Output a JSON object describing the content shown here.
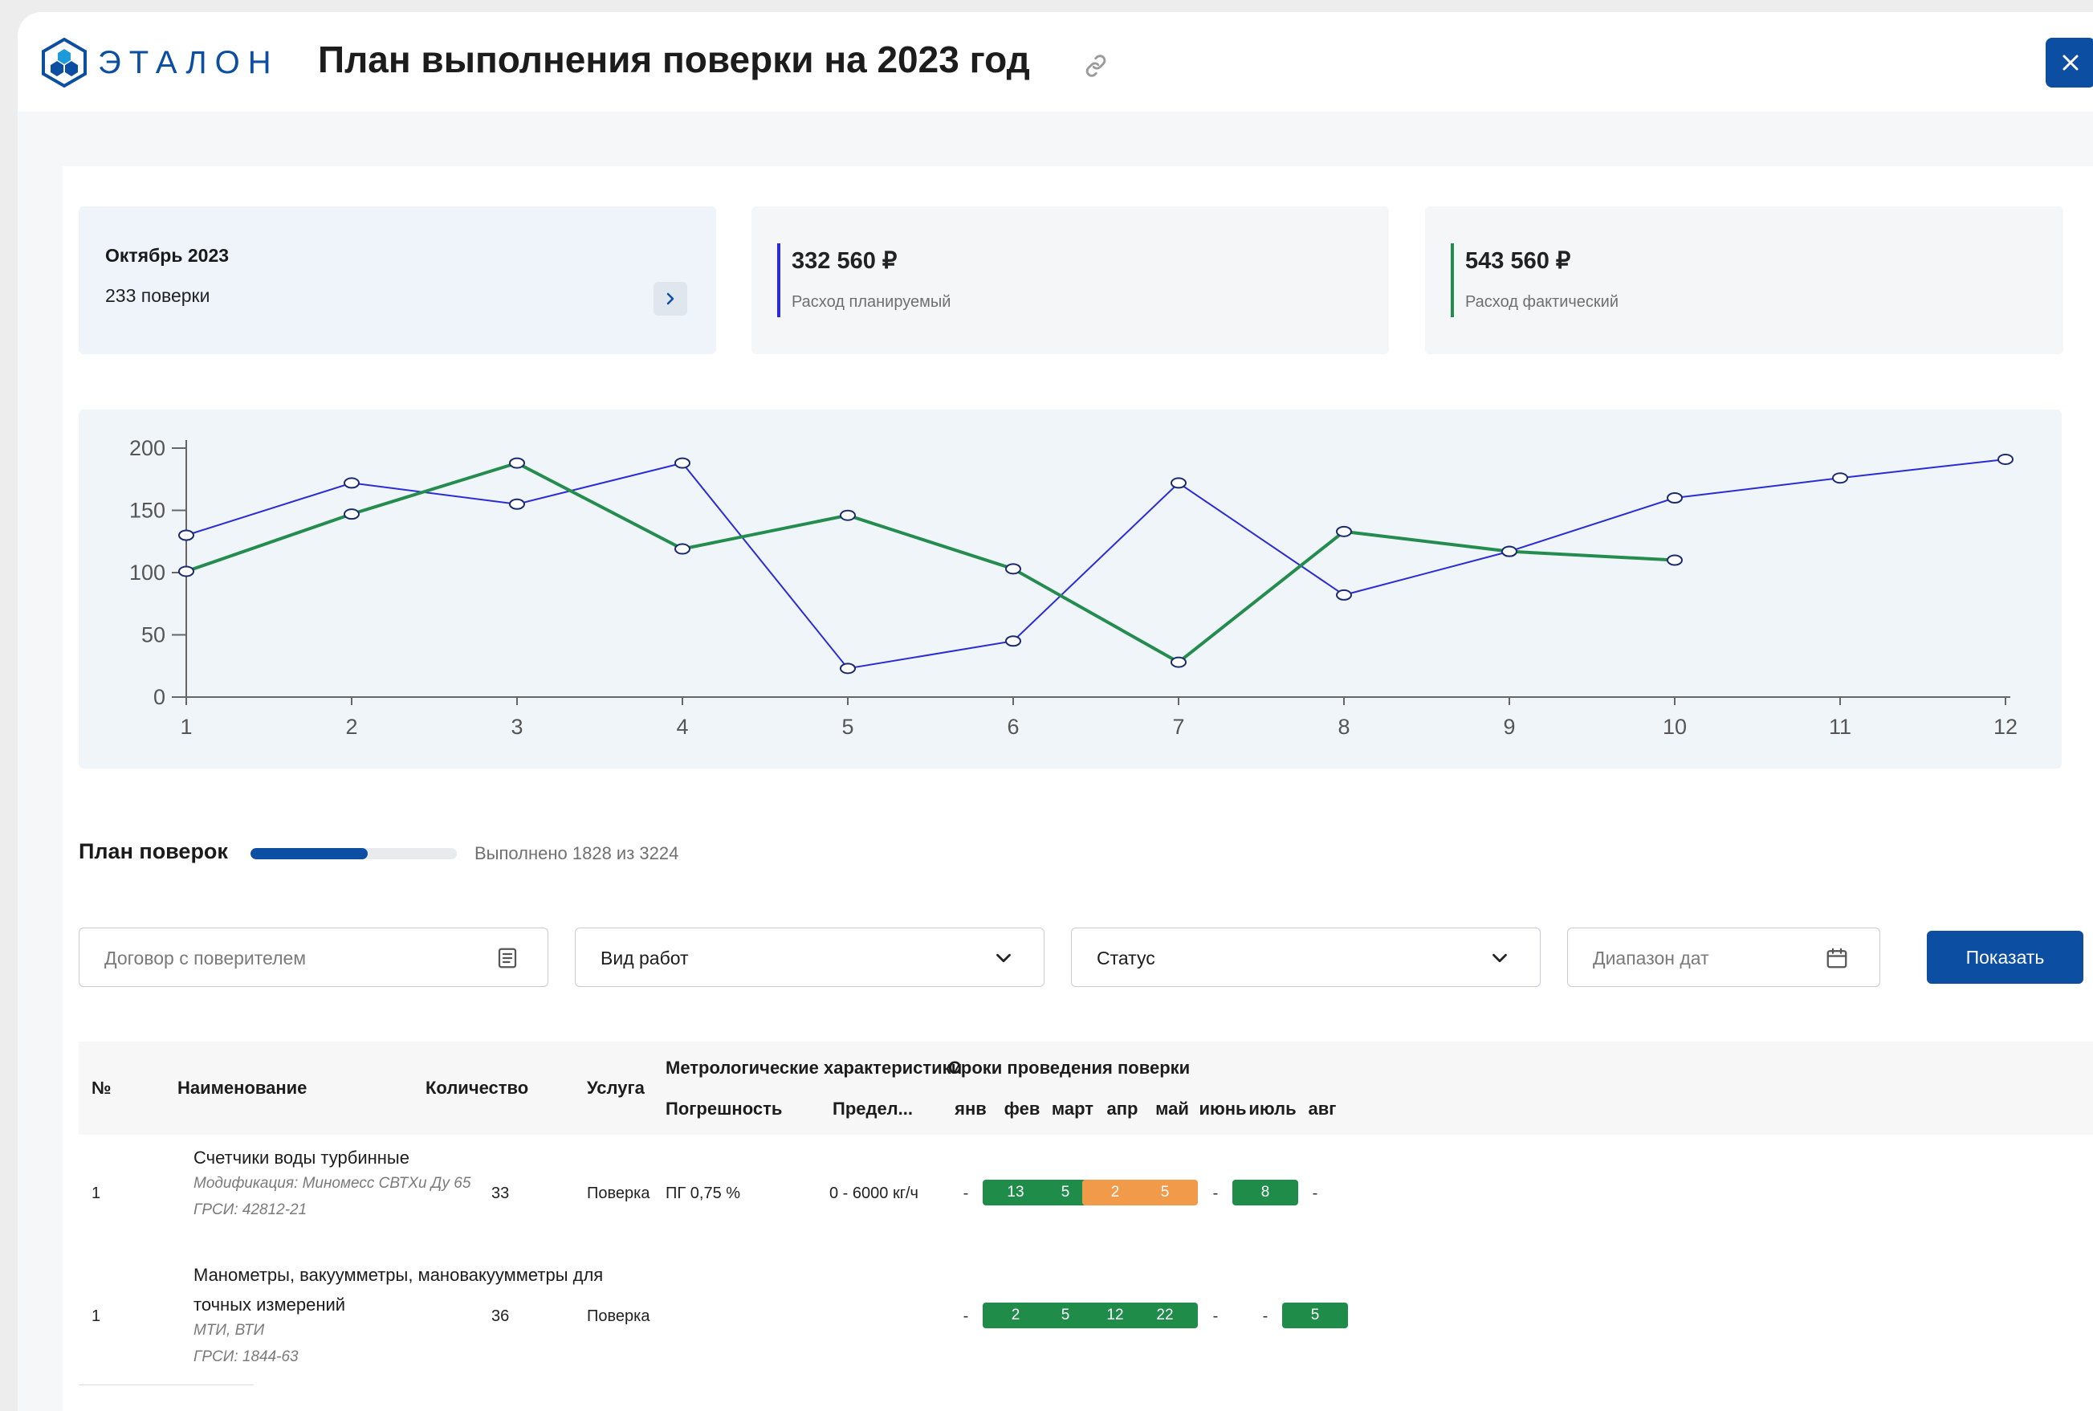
{
  "app": {
    "logo_text": "ЭТАЛОН",
    "title": "План выполнения поверки на 2023 год"
  },
  "summary": {
    "period": {
      "title": "Октябрь 2023",
      "subtitle": "233 поверки"
    },
    "planned": {
      "amount": "332 560 ₽",
      "label": "Расход планируемый",
      "color": "#2b2bd6"
    },
    "actual": {
      "amount": "543 560 ₽",
      "label": "Расход фактический",
      "color": "#238c4e"
    }
  },
  "chart_data": {
    "type": "line",
    "x": [
      1,
      2,
      3,
      4,
      5,
      6,
      7,
      8,
      9,
      10,
      11,
      12
    ],
    "xlim": [
      1,
      12
    ],
    "ylim": [
      0,
      200
    ],
    "yticks": [
      0,
      50,
      100,
      150,
      200
    ],
    "series": [
      {
        "color": "#2b2bd6",
        "values": [
          130,
          172,
          155,
          188,
          23,
          45,
          172,
          82,
          117,
          160,
          176,
          191
        ]
      },
      {
        "color": "#238c4e",
        "values": [
          101,
          147,
          188,
          119,
          146,
          103,
          28,
          133,
          117,
          110
        ]
      }
    ]
  },
  "plan": {
    "title": "План поверок",
    "progress_text": "Выполнено 1828 из 3224",
    "done": 1828,
    "total": 3224
  },
  "filters": {
    "contract_placeholder": "Договор с поверителем",
    "work_type": "Вид работ",
    "status": "Статус",
    "date_range_placeholder": "Диапазон дат",
    "show_button": "Показать"
  },
  "table": {
    "headers": {
      "num": "№",
      "name": "Наименование",
      "qty": "Количество",
      "service": "Услуга",
      "metro": "Метрологические характеристики",
      "error": "Погрешность",
      "limit": "Предел...",
      "terms": "Сроки проведения поверки"
    },
    "months": [
      "янв",
      "фев",
      "март",
      "апр",
      "май",
      "июнь",
      "июль",
      "авг"
    ],
    "rows": [
      {
        "num": "1",
        "name_lines": [
          "Счетчики воды турбинные"
        ],
        "modification": "Модификация: Миномесс СВТХи Ду 65",
        "grsi": "ГРСИ: 42812-21",
        "qty": "33",
        "service": "Поверка",
        "error": "ПГ 0,75 %",
        "limit": "0 - 6000 кг/ч",
        "months": [
          {
            "value": "-",
            "status": "none"
          },
          {
            "value": "13",
            "status": "done"
          },
          {
            "value": "5",
            "status": "done"
          },
          {
            "value": "2",
            "status": "pending"
          },
          {
            "value": "5",
            "status": "pending"
          },
          {
            "value": "-",
            "status": "none"
          },
          {
            "value": "8",
            "status": "done"
          },
          {
            "value": "-",
            "status": "none"
          }
        ]
      },
      {
        "num": "1",
        "name_lines": [
          "Манометры, вакуумметры, мановакуумметры для",
          "точных измерений"
        ],
        "modification": "МТИ, ВТИ",
        "grsi": "ГРСИ: 1844-63",
        "qty": "36",
        "service": "Поверка",
        "error": "",
        "limit": "",
        "months": [
          {
            "value": "-",
            "status": "none"
          },
          {
            "value": "2",
            "status": "done"
          },
          {
            "value": "5",
            "status": "done"
          },
          {
            "value": "12",
            "status": "done"
          },
          {
            "value": "22",
            "status": "done"
          },
          {
            "value": "-",
            "status": "none"
          },
          {
            "value": "-",
            "status": "none"
          },
          {
            "value": "5",
            "status": "done"
          }
        ]
      }
    ]
  }
}
